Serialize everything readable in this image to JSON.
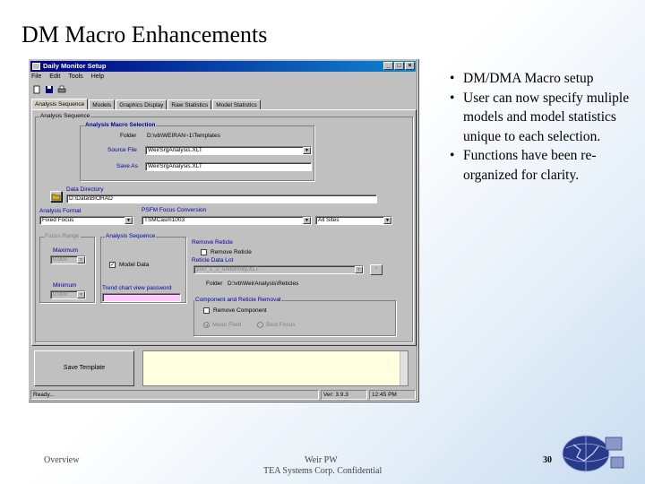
{
  "slide": {
    "title": "DM Macro Enhancements",
    "bullets": [
      "DM/DMA Macro setup",
      "User can now specify muliple models and model statistics unique to each selection.",
      "Functions have been re-organized for clarity."
    ],
    "footer": {
      "left": "Overview",
      "center_top": "Weir PW",
      "center_bottom": "TEA Systems Corp. Confidential",
      "page": "30"
    }
  },
  "window": {
    "title": "Daily Monitor Setup",
    "menu": [
      "File",
      "Edit",
      "Tools",
      "Help"
    ],
    "tabs": [
      "Analysis Sequence",
      "Models",
      "Graphics Display",
      "Raw Statistics",
      "Model Statistics"
    ],
    "active_tab": 0,
    "group_analysis_sequence": "Analysis Sequence",
    "analysis_macro": {
      "label": "Analysis Macro Selection",
      "folder_label": "Folder",
      "folder_value": "D:\\vb\\WEIRAN~1\\Templates",
      "source_file_label": "Source File",
      "source_file_value": "WeirSrgAnalysis.XLT",
      "save_as_label": "Save As",
      "save_as_value": "WeirSrgAnalysis.XLT"
    },
    "data_directory": {
      "label": "Data Directory",
      "value": "D:\\Data\\BIORAD"
    },
    "analysis_format": {
      "label": "Analysis Format",
      "value": "Fixed Focus"
    },
    "psfm_focus": {
      "label": "PSFM Focus Conversion",
      "value": "TSMCasm1003",
      "sites_value": "All Sites"
    },
    "focus_range": {
      "label": "Focus Range",
      "max_label": "Maximum",
      "max_value": "0.000",
      "min_label": "Minimum",
      "min_value": "0.000"
    },
    "analysis_sequence2": {
      "label": "Analysis Sequence",
      "model_data_label": "Model Data",
      "trend_label": "Trend chart view password",
      "trend_value": ""
    },
    "remove_reticle": {
      "label": "Remove Reticle",
      "checkbox_label": "Remove Reticle",
      "lot_label": "Reticle Data Lot",
      "lot_value": "100_1_2_uniformity.XLT",
      "folder_label": "Folder",
      "folder_value": "D:\\vb\\WeirAnalysis\\Reticles"
    },
    "component": {
      "label": "Component and Reticle Removal",
      "remove_label": "Remove Component",
      "mean_field": "Mean Field",
      "best_focus": "Best Focus"
    },
    "save_template": "Save Template",
    "status": {
      "ready": "Ready...",
      "version": "Ver: 3.9.3",
      "time": "12:45 PM"
    }
  },
  "colors": {
    "titlebar": "#000080",
    "window_bg": "#c0c0c0",
    "group_label": "#0000a0",
    "password_field": "#ffc8ff"
  }
}
